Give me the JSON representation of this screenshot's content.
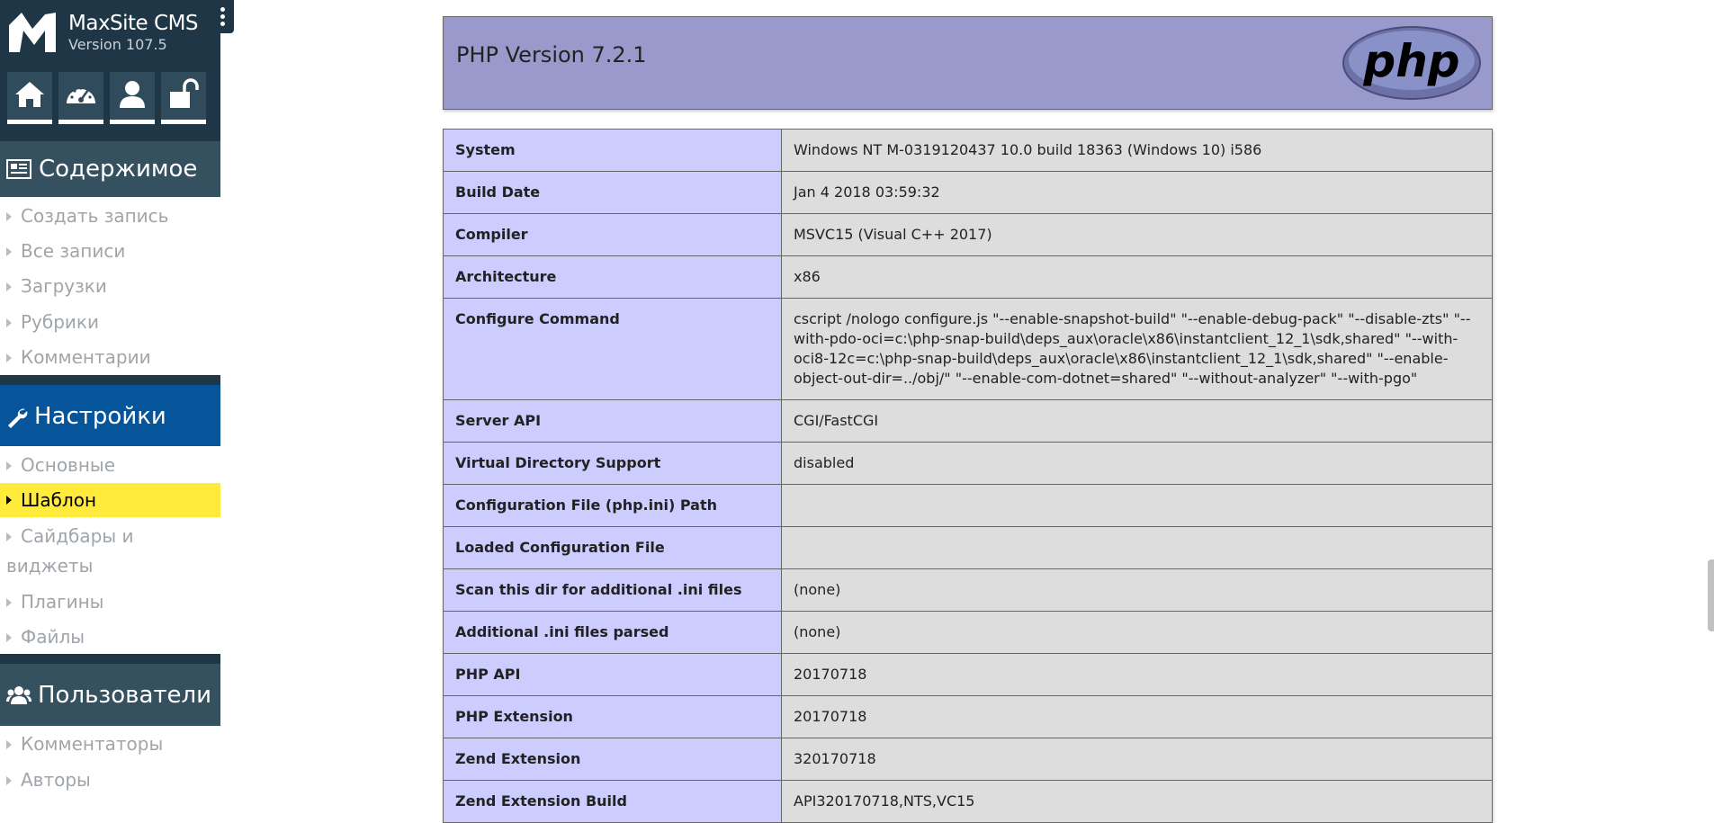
{
  "brand": {
    "title": "MaxSite CMS",
    "version": "Version 107.5"
  },
  "toolbar": {
    "buttons": [
      {
        "icon": "home-icon"
      },
      {
        "icon": "dashboard-icon"
      },
      {
        "icon": "user-icon"
      },
      {
        "icon": "unlock-icon"
      }
    ]
  },
  "sidebar": {
    "content": {
      "title": "Содержимое",
      "items": [
        "Создать запись",
        "Все записи",
        "Загрузки",
        "Рубрики",
        "Комментарии"
      ]
    },
    "settings": {
      "title": "Настройки",
      "items": [
        "Основные",
        "Шаблон",
        "Сайдбары и",
        "виджеты",
        "Плагины",
        "Файлы"
      ],
      "active": "Шаблон"
    },
    "users": {
      "title": "Пользователи",
      "items": [
        "Комментаторы",
        "Авторы"
      ]
    }
  },
  "php": {
    "version": "PHP Version 7.2.1",
    "logo_text": "php",
    "rows": [
      {
        "key": "System",
        "value": "Windows NT M-0319120437 10.0 build 18363 (Windows 10) i586"
      },
      {
        "key": "Build Date",
        "value": "Jan 4 2018 03:59:32"
      },
      {
        "key": "Compiler",
        "value": "MSVC15 (Visual C++ 2017)"
      },
      {
        "key": "Architecture",
        "value": "x86"
      },
      {
        "key": "Configure Command",
        "value": "cscript /nologo configure.js \"--enable-snapshot-build\" \"--enable-debug-pack\" \"--disable-zts\" \"--with-pdo-oci=c:\\php-snap-build\\deps_aux\\oracle\\x86\\instantclient_12_1\\sdk,shared\" \"--with-oci8-12c=c:\\php-snap-build\\deps_aux\\oracle\\x86\\instantclient_12_1\\sdk,shared\" \"--enable-object-out-dir=../obj/\" \"--enable-com-dotnet=shared\" \"--without-analyzer\" \"--with-pgo\""
      },
      {
        "key": "Server API",
        "value": "CGI/FastCGI"
      },
      {
        "key": "Virtual Directory Support",
        "value": "disabled"
      },
      {
        "key": "Configuration File (php.ini) Path",
        "value": ""
      },
      {
        "key": "Loaded Configuration File",
        "value": ""
      },
      {
        "key": "Scan this dir for additional .ini files",
        "value": "(none)"
      },
      {
        "key": "Additional .ini files parsed",
        "value": "(none)"
      },
      {
        "key": "PHP API",
        "value": "20170718"
      },
      {
        "key": "PHP Extension",
        "value": "20170718"
      },
      {
        "key": "Zend Extension",
        "value": "320170718"
      },
      {
        "key": "Zend Extension Build",
        "value": "API320170718,NTS,VC15"
      }
    ]
  },
  "colors": {
    "sidebar_dark": "#1e3645",
    "section_dark": "#35505f",
    "section_blue": "#06549a",
    "active_item": "#ffeb3b",
    "php_header": "#9999cc",
    "php_key": "#ccccff",
    "php_value": "#dddddd"
  }
}
